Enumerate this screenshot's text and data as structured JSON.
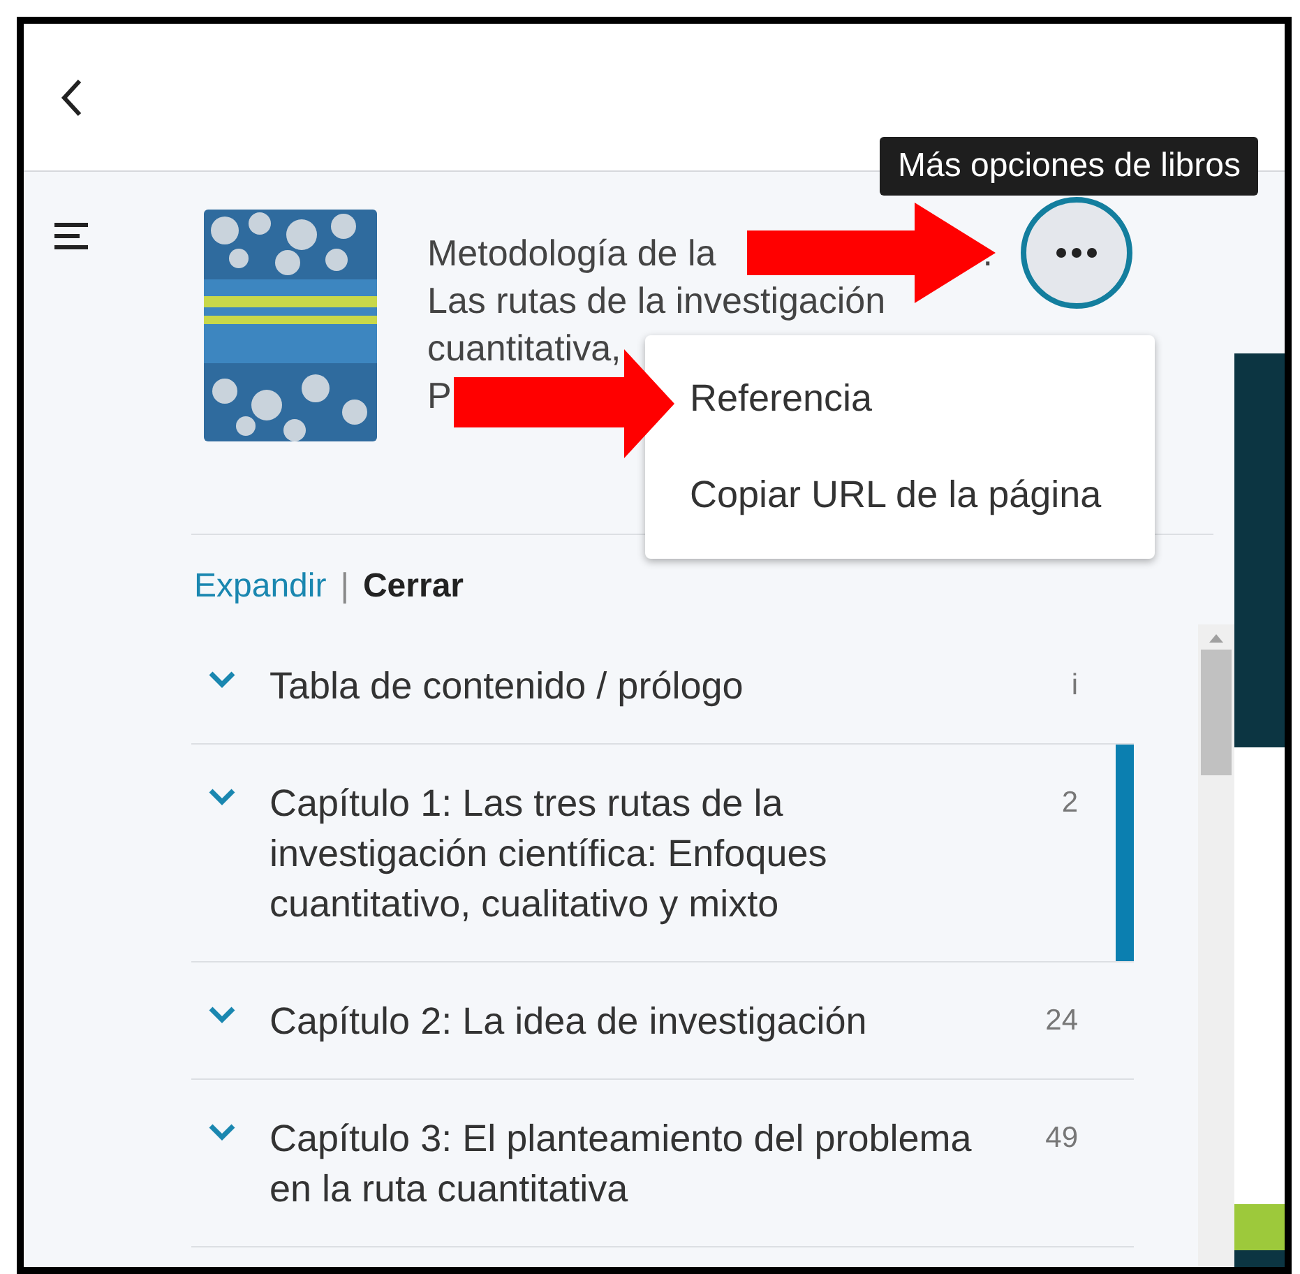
{
  "tooltip": "Más opciones de libros",
  "book": {
    "title_lines": [
      [
        "Metodología de la",
        "."
      ],
      [
        "Las rutas de la investigación"
      ],
      [
        "cuantitativa,"
      ],
      [
        "P"
      ]
    ]
  },
  "menu": {
    "items": [
      "Referencia",
      "Copiar URL de la página"
    ]
  },
  "outline_controls": {
    "expand": "Expandir",
    "separator": "|",
    "collapse": "Cerrar"
  },
  "chapters": [
    {
      "title": "Tabla de contenido / prólogo",
      "page": "i",
      "selected": false
    },
    {
      "title": "Capítulo 1: Las tres rutas de la investigación científica: Enfoques cuantitativo, cualitativo y mixto",
      "page": "2",
      "selected": true
    },
    {
      "title": "Capítulo 2: La idea de investigación",
      "page": "24",
      "selected": false
    },
    {
      "title": "Capítulo 3: El planteamiento del problema en la ruta cuantitativa",
      "page": "49",
      "selected": false
    }
  ]
}
